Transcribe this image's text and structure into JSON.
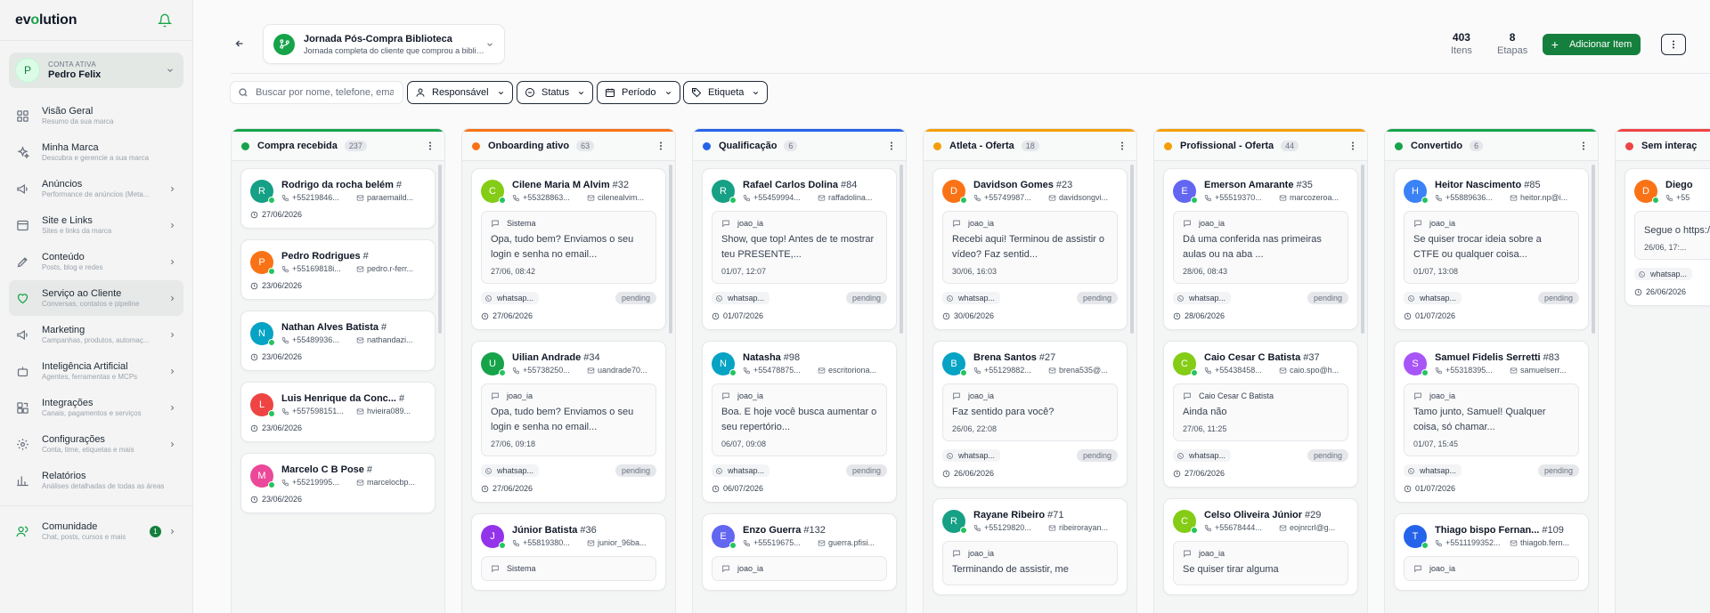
{
  "app": {
    "logo_pre": "ev",
    "logo_o": "o",
    "logo_post": "lution"
  },
  "account": {
    "initial": "P",
    "label": "CONTA ATIVA",
    "name": "Pedro Felix"
  },
  "sidebar": {
    "items": [
      {
        "title": "Visão Geral",
        "sub": "Resumo da sua marca",
        "icon": "grid-icon",
        "chevron": false
      },
      {
        "title": "Minha Marca",
        "sub": "Descubra e gerencie a sua marca",
        "icon": "sparkles-icon",
        "chevron": false
      },
      {
        "title": "Anúncios",
        "sub": "Performance de anúncios (Meta...",
        "icon": "megaphone-icon",
        "chevron": true
      },
      {
        "title": "Site e Links",
        "sub": "Sites e links da marca",
        "icon": "window-icon",
        "chevron": true
      },
      {
        "title": "Conteúdo",
        "sub": "Posts, blog e redes",
        "icon": "pen-icon",
        "chevron": true
      },
      {
        "title": "Serviço ao Cliente",
        "sub": "Conversas, contatos e pipeline",
        "icon": "heart-handshake-icon",
        "chevron": true
      },
      {
        "title": "Marketing",
        "sub": "Campanhas, produtos, automaç...",
        "icon": "megaphone-icon",
        "chevron": true
      },
      {
        "title": "Inteligência Artificial",
        "sub": "Agentes, ferramentas e MCPs",
        "icon": "bot-icon",
        "chevron": true
      },
      {
        "title": "Integrações",
        "sub": "Canais, pagamentos e serviços",
        "icon": "blocks-icon",
        "chevron": true
      },
      {
        "title": "Configurações",
        "sub": "Conta, time, etiquetas e mais",
        "icon": "gear-icon",
        "chevron": true
      },
      {
        "title": "Relatórios",
        "sub": "Análises detalhadas de todas as áreas",
        "icon": "bar-chart-icon",
        "chevron": false
      }
    ],
    "community": {
      "title": "Comunidade",
      "sub": "Chat, posts, cursos e mais",
      "badge": "1"
    }
  },
  "header": {
    "journey_title": "Jornada Pós-Compra Biblioteca",
    "journey_sub": "Jornada completa do cliente que comprou a biblioteca",
    "items_count": "403",
    "items_label": "Itens",
    "stages_count": "8",
    "stages_label": "Etapas",
    "add_label": "Adicionar Item"
  },
  "filters": {
    "search_placeholder": "Buscar por nome, telefone, email...",
    "responsavel": "Responsável",
    "status": "Status",
    "periodo": "Período",
    "etiqueta": "Etiqueta"
  },
  "columns": [
    {
      "title": "Compra recebida",
      "count": "237",
      "color": "#16a34a",
      "cards": [
        {
          "initial": "R",
          "avatar": "#16a085",
          "name": "Rodrigo da rocha belém",
          "num": "#",
          "phone": "+55219846...",
          "email": "paraemaild...",
          "date": "27/06/2026"
        },
        {
          "initial": "P",
          "avatar": "#f97316",
          "name": "Pedro Rodrigues",
          "num": "#",
          "phone": "+55169818i...",
          "email": "pedro.r-ferr...",
          "date": "23/06/2026"
        },
        {
          "initial": "N",
          "avatar": "#06a3c4",
          "name": "Nathan Alves Batista",
          "num": "#",
          "phone": "+55489936...",
          "email": "nathandazi...",
          "date": "23/06/2026"
        },
        {
          "initial": "L",
          "avatar": "#ef4444",
          "name": "Luis Henrique da Conc...",
          "num": "#",
          "phone": "+557598151...",
          "email": "hvieira089...",
          "date": "23/06/2026"
        },
        {
          "initial": "M",
          "avatar": "#ec4899",
          "name": "Marcelo C B Pose",
          "num": "#",
          "phone": "+55219995...",
          "email": "marcelocbp...",
          "date": "23/06/2026"
        }
      ]
    },
    {
      "title": "Onboarding ativo",
      "count": "63",
      "color": "#f97316",
      "cards": [
        {
          "initial": "C",
          "avatar": "#84cc16",
          "name": "Cilene Maria M Alvim",
          "num": "#32",
          "phone": "+55328863...",
          "email": "cilenealvim...",
          "sender": "Sistema",
          "msg": "Opa, tudo bem? Enviamos o seu login e senha no email...",
          "time": "27/06, 08:42",
          "channel": "whatsap...",
          "status": "pending",
          "date": "27/06/2026"
        },
        {
          "initial": "U",
          "avatar": "#16a34a",
          "name": "Uilian Andrade",
          "num": "#34",
          "phone": "+55738250...",
          "email": "uandrade70...",
          "sender": "joao_ia",
          "msg": "Opa, tudo bem? Enviamos o seu login e senha no email...",
          "time": "27/06, 09:18",
          "channel": "whatsap...",
          "status": "pending",
          "date": "27/06/2026"
        },
        {
          "initial": "J",
          "avatar": "#9333ea",
          "name": "Júnior Batista",
          "num": "#36",
          "phone": "+55819380...",
          "email": "junior_96ba...",
          "sender": "Sistema",
          "msg": "",
          "time": "",
          "channel": "",
          "status": "",
          "date": ""
        }
      ]
    },
    {
      "title": "Qualificação",
      "count": "6",
      "color": "#2563eb",
      "cards": [
        {
          "initial": "R",
          "avatar": "#16a085",
          "name": "Rafael Carlos Dolina",
          "num": "#84",
          "phone": "+55459994...",
          "email": "raffadolina...",
          "sender": "joao_ia",
          "msg": "Show, que top! Antes de te mostrar teu PRESENTE,...",
          "time": "01/07, 12:07",
          "channel": "whatsap...",
          "status": "pending",
          "date": "01/07/2026"
        },
        {
          "initial": "N",
          "avatar": "#06a3c4",
          "name": "Natasha",
          "num": "#98",
          "phone": "+55478875...",
          "email": "escritoriona...",
          "sender": "joao_ia",
          "msg": "Boa. E hoje você busca aumentar o seu repertório...",
          "time": "06/07, 09:08",
          "channel": "whatsap...",
          "status": "pending",
          "date": "06/07/2026"
        },
        {
          "initial": "E",
          "avatar": "#6366f1",
          "name": "Enzo Guerra",
          "num": "#132",
          "phone": "+55519675...",
          "email": "guerra.pfisi...",
          "sender": "joao_ia",
          "msg": "",
          "time": "",
          "channel": "",
          "status": "",
          "date": ""
        }
      ]
    },
    {
      "title": "Atleta - Oferta",
      "count": "18",
      "color": "#f59e0b",
      "cards": [
        {
          "initial": "D",
          "avatar": "#f97316",
          "name": "Davidson Gomes",
          "num": "#23",
          "phone": "+55749987...",
          "email": "davidsongvi...",
          "sender": "joao_ia",
          "msg": "Recebi aqui! Terminou de assistir o vídeo? Faz sentid...",
          "time": "30/06, 16:03",
          "channel": "whatsap...",
          "status": "pending",
          "date": "30/06/2026"
        },
        {
          "initial": "B",
          "avatar": "#06a3c4",
          "name": "Brena Santos",
          "num": "#27",
          "phone": "+55129882...",
          "email": "brena535@...",
          "sender": "joao_ia",
          "msg": "Faz sentido para você?",
          "time": "26/06, 22:08",
          "channel": "whatsap...",
          "status": "pending",
          "date": "26/06/2026"
        },
        {
          "initial": "R",
          "avatar": "#16a085",
          "name": "Rayane Ribeiro",
          "num": "#71",
          "phone": "+55129820...",
          "email": "ribeirorayan...",
          "sender": "joao_ia",
          "msg": "Terminando de assistir, me",
          "time": "",
          "channel": "",
          "status": "",
          "date": ""
        }
      ]
    },
    {
      "title": "Profissional - Oferta",
      "count": "44",
      "color": "#f59e0b",
      "cards": [
        {
          "initial": "E",
          "avatar": "#6366f1",
          "name": "Emerson Amarante",
          "num": "#35",
          "phone": "+55519370...",
          "email": "marcozeroa...",
          "sender": "joao_ia",
          "msg": "Dá uma conferida nas primeiras aulas ou na aba ...",
          "time": "28/06, 08:43",
          "channel": "whatsap...",
          "status": "pending",
          "date": "28/06/2026"
        },
        {
          "initial": "C",
          "avatar": "#84cc16",
          "name": "Caio Cesar C Batista",
          "num": "#37",
          "phone": "+55438458...",
          "email": "caio.spo@h...",
          "sender": "Caio Cesar C Batista",
          "msg": "Ainda não",
          "time": "27/06, 11:25",
          "channel": "whatsap...",
          "status": "pending",
          "date": "27/06/2026"
        },
        {
          "initial": "C",
          "avatar": "#84cc16",
          "name": "Celso Oliveira Júnior",
          "num": "#29",
          "phone": "+55678444...",
          "email": "eojnrcrl@g...",
          "sender": "joao_ia",
          "msg": "Se quiser tirar alguma",
          "time": "",
          "channel": "",
          "status": "",
          "date": ""
        }
      ]
    },
    {
      "title": "Convertido",
      "count": "6",
      "color": "#16a34a",
      "cards": [
        {
          "initial": "H",
          "avatar": "#3b82f6",
          "name": "Heitor Nascimento",
          "num": "#85",
          "phone": "+55889636...",
          "email": "heitor.np@i...",
          "sender": "joao_ia",
          "msg": "Se quiser trocar ideia sobre a CTFE ou qualquer coisa...",
          "time": "01/07, 13:08",
          "channel": "whatsap...",
          "status": "pending",
          "date": "01/07/2026"
        },
        {
          "initial": "S",
          "avatar": "#a855f7",
          "name": "Samuel Fidelis Serretti",
          "num": "#83",
          "phone": "+55318395...",
          "email": "samuelserr...",
          "sender": "joao_ia",
          "msg": "Tamo junto, Samuel! Qualquer coisa, só chamar...",
          "time": "01/07, 15:45",
          "channel": "whatsap...",
          "status": "pending",
          "date": "01/07/2026"
        },
        {
          "initial": "T",
          "avatar": "#2563eb",
          "name": "Thiago bispo Fernan...",
          "num": "#109",
          "phone": "+5511199352...",
          "email": "thiagob.fern...",
          "sender": "joao_ia",
          "msg": "",
          "time": "",
          "channel": "",
          "status": "",
          "date": ""
        }
      ]
    },
    {
      "title": "Sem interaç",
      "count": "",
      "color": "#ef4444",
      "cards": [
        {
          "initial": "D",
          "avatar": "#f97316",
          "name": "Diego",
          "num": "",
          "phone": "+55",
          "email": "",
          "sender": "",
          "msg": "Segue o https://p",
          "time": "26/06, 17:...",
          "channel": "whatsap...",
          "status": "",
          "date": "26/06/2026"
        }
      ]
    }
  ]
}
